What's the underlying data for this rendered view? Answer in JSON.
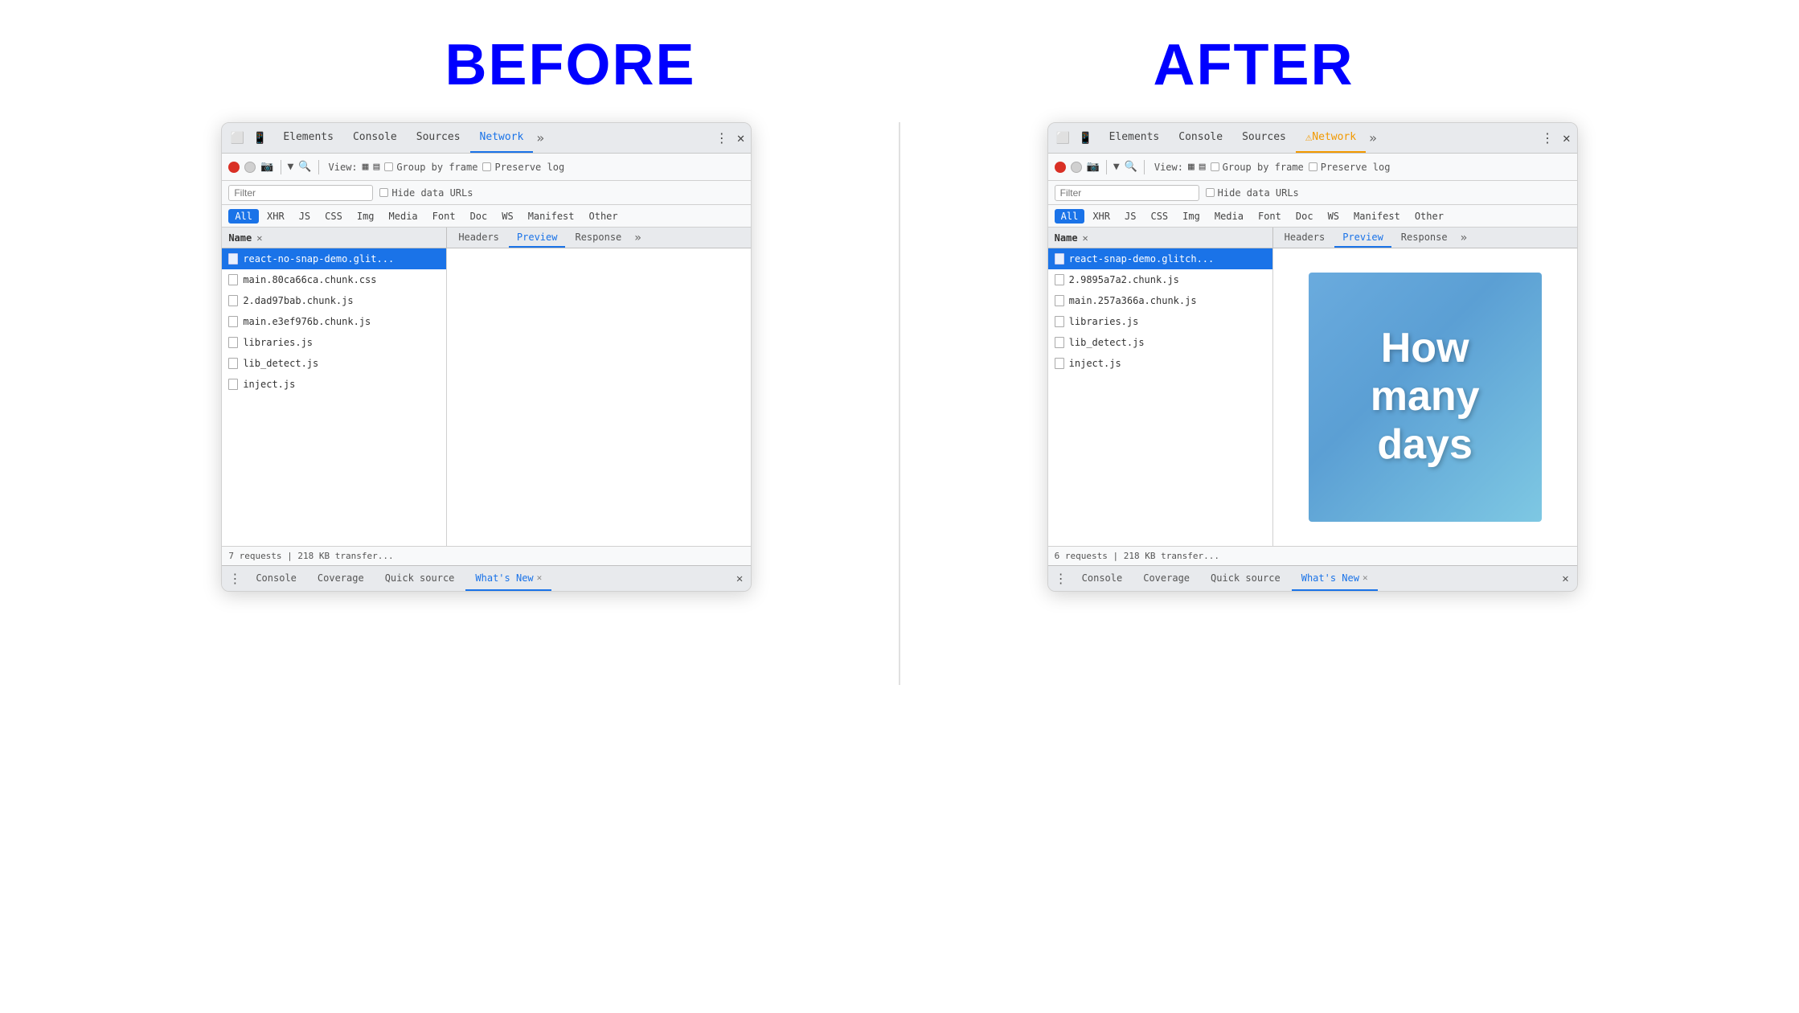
{
  "before_label": "BEFORE",
  "after_label": "AFTER",
  "before_panel": {
    "tabs": [
      "Elements",
      "Console",
      "Sources",
      "Network"
    ],
    "active_tab": "Network",
    "toolbar": {
      "view_label": "View:",
      "group_by_frame": "Group by frame",
      "preserve_log": "Preserve log"
    },
    "filter_placeholder": "Filter",
    "hide_data_urls": "Hide data URLs",
    "type_filters": [
      "All",
      "XHR",
      "JS",
      "CSS",
      "Img",
      "Media",
      "Font",
      "Doc",
      "WS",
      "Manifest",
      "Other"
    ],
    "active_type": "All",
    "columns": [
      "Name"
    ],
    "detail_tabs": [
      "Headers",
      "Preview",
      "Response"
    ],
    "active_detail_tab": "Preview",
    "files": [
      "react-no-snap-demo.glit...",
      "main.80ca66ca.chunk.css",
      "2.dad97bab.chunk.js",
      "main.e3ef976b.chunk.js",
      "libraries.js",
      "lib_detect.js",
      "inject.js"
    ],
    "selected_file_index": 0,
    "status": "7 requests | 218 KB transfer...",
    "bottom_tabs": [
      "Console",
      "Coverage",
      "Quick source",
      "What's New"
    ],
    "active_bottom_tab": "What's New"
  },
  "after_panel": {
    "tabs": [
      "Elements",
      "Console",
      "Sources",
      "Network"
    ],
    "active_tab": "Network",
    "active_tab_warn": true,
    "toolbar": {
      "view_label": "View:",
      "group_by_frame": "Group by frame",
      "preserve_log": "Preserve log"
    },
    "filter_placeholder": "Filter",
    "hide_data_urls": "Hide data URLs",
    "type_filters": [
      "All",
      "XHR",
      "JS",
      "CSS",
      "Img",
      "Media",
      "Font",
      "Doc",
      "WS",
      "Manifest",
      "Other"
    ],
    "active_type": "All",
    "columns": [
      "Name"
    ],
    "detail_tabs": [
      "Headers",
      "Preview",
      "Response"
    ],
    "active_detail_tab": "Preview",
    "files": [
      "react-snap-demo.glitch...",
      "2.9895a7a2.chunk.js",
      "main.257a366a.chunk.js",
      "libraries.js",
      "lib_detect.js",
      "inject.js"
    ],
    "selected_file_index": 0,
    "preview_text": "How\nmany\ndays",
    "status": "6 requests | 218 KB transfer...",
    "bottom_tabs": [
      "Console",
      "Coverage",
      "Quick source",
      "What's New"
    ],
    "active_bottom_tab": "What's New"
  },
  "icons": {
    "record": "⏺",
    "stop": "🚫",
    "camera": "📷",
    "filter": "⚡",
    "search": "🔍",
    "grid": "▦",
    "grid2": "▤",
    "more": "»",
    "more_vert": "⋮",
    "close": "✕",
    "file": "📄",
    "chevron": "›"
  }
}
